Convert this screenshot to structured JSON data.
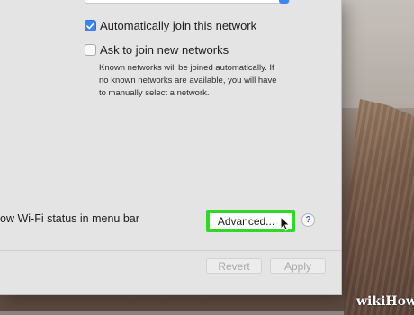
{
  "join": {
    "auto_join_label": "Automatically join this network",
    "auto_join_checked": true,
    "ask_join_label": "Ask to join new networks",
    "ask_join_checked": false,
    "help_lines": [
      "Known networks will be joined automatically. If",
      "no known networks are available, you will have",
      "to manually select a network."
    ]
  },
  "status_bar": {
    "label": "ow Wi-Fi status in menu bar",
    "advanced_label": "Advanced...",
    "help_label": "?"
  },
  "footer": {
    "revert_label": "Revert",
    "apply_label": "Apply"
  },
  "watermark": {
    "wiki": "wiki",
    "how": "How"
  },
  "colors": {
    "checkbox_accent": "#3a86f0",
    "highlight": "#33d62b",
    "disabled_text": "#a9a9a9"
  }
}
